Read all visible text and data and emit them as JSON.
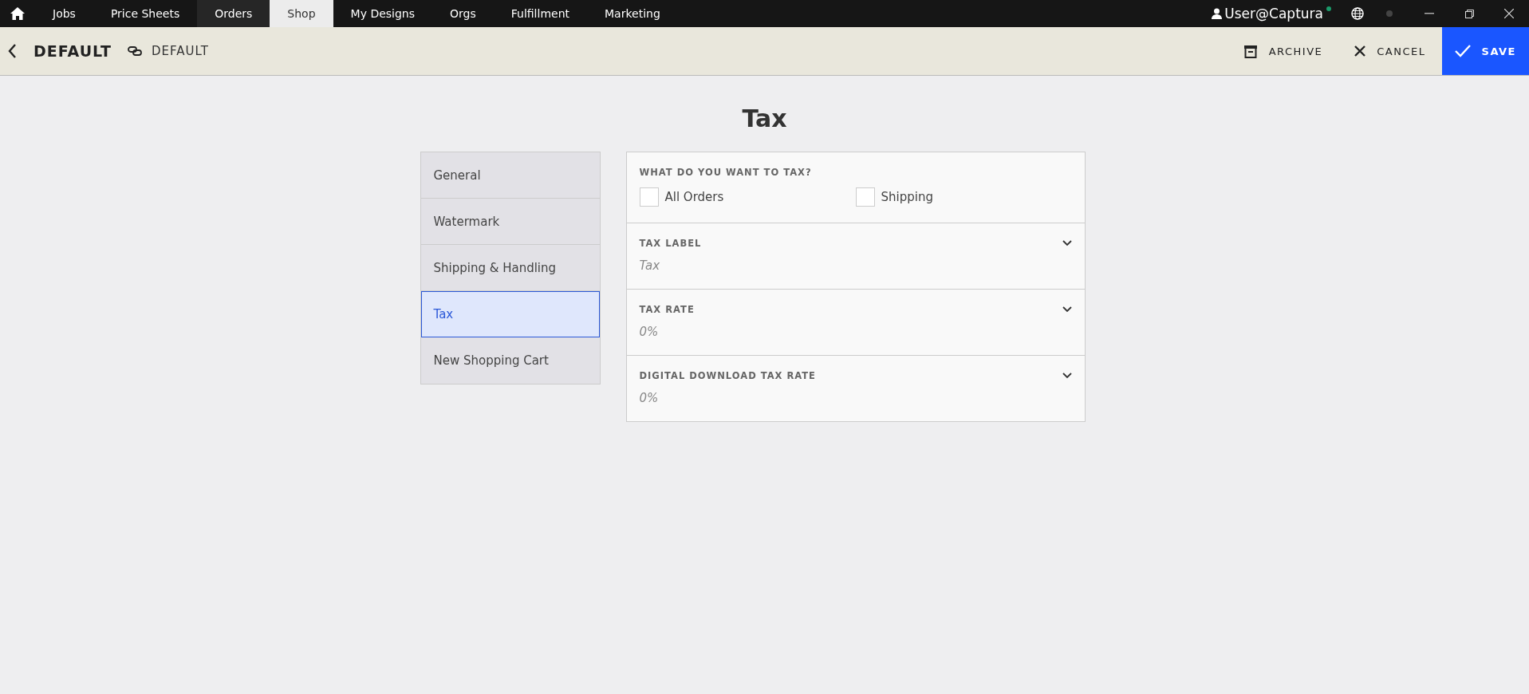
{
  "nav": {
    "tabs": [
      {
        "label": "Jobs",
        "selected": false,
        "highlighted": false
      },
      {
        "label": "Price Sheets",
        "selected": false,
        "highlighted": false
      },
      {
        "label": "Orders",
        "selected": false,
        "highlighted": true
      },
      {
        "label": "Shop",
        "selected": true,
        "highlighted": false
      },
      {
        "label": "My Designs",
        "selected": false,
        "highlighted": false
      },
      {
        "label": "Orgs",
        "selected": false,
        "highlighted": false
      },
      {
        "label": "Fulfillment",
        "selected": false,
        "highlighted": false
      },
      {
        "label": "Marketing",
        "selected": false,
        "highlighted": false
      }
    ],
    "user": "User@Captura"
  },
  "header": {
    "title": "DEFAULT",
    "link_label": "DEFAULT",
    "actions": [
      {
        "label": "ARCHIVE",
        "kind": "archive"
      },
      {
        "label": "CANCEL",
        "kind": "cancel"
      },
      {
        "label": "SAVE",
        "kind": "save"
      }
    ]
  },
  "page_title": "Tax",
  "sidebar": {
    "items": [
      {
        "label": "General",
        "selected": false
      },
      {
        "label": "Watermark",
        "selected": false
      },
      {
        "label": "Shipping & Handling",
        "selected": false
      },
      {
        "label": "Tax",
        "selected": true
      },
      {
        "label": "New Shopping Cart",
        "selected": false
      }
    ]
  },
  "form": {
    "question": "WHAT DO YOU WANT TO TAX?",
    "checkboxes": [
      {
        "label": "All Orders",
        "checked": false
      },
      {
        "label": "Shipping",
        "checked": false
      }
    ],
    "fields": [
      {
        "label": "TAX LABEL",
        "placeholder": "Tax"
      },
      {
        "label": "TAX RATE",
        "placeholder": "0%"
      },
      {
        "label": "DIGITAL DOWNLOAD TAX RATE",
        "placeholder": "0%"
      }
    ]
  }
}
